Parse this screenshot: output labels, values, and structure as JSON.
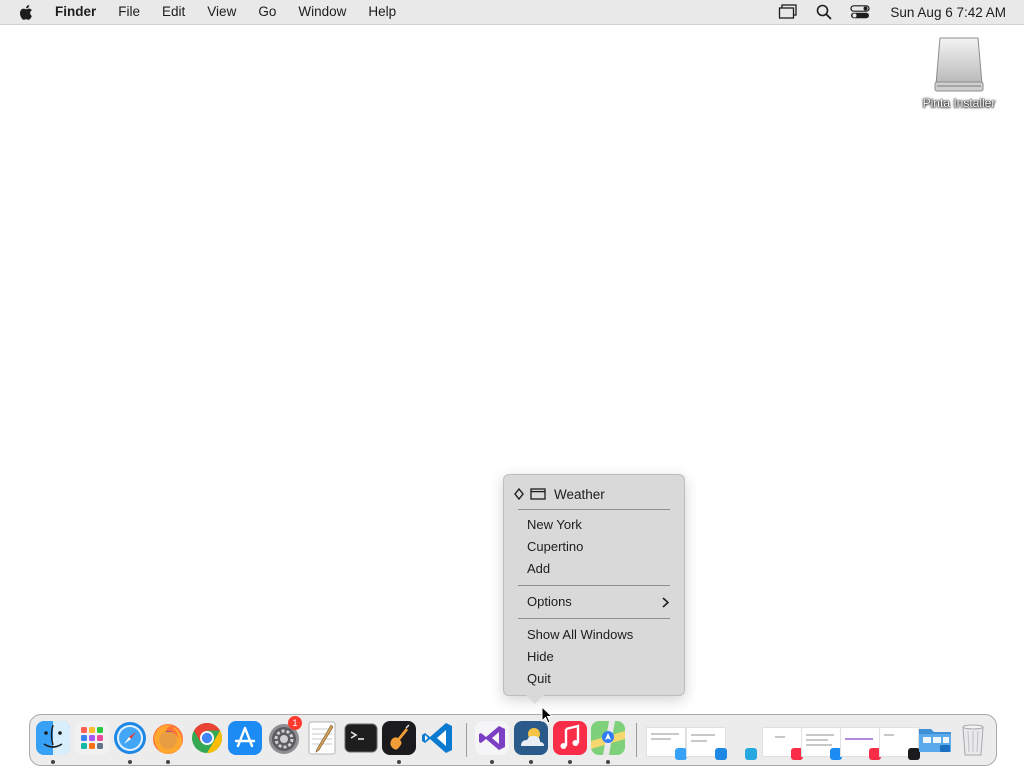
{
  "menubar": {
    "apple_icon": "apple-logo-icon",
    "app_name": "Finder",
    "items": [
      "File",
      "Edit",
      "View",
      "Go",
      "Window",
      "Help"
    ],
    "status_icons": [
      "display-icon",
      "search-icon",
      "control-center-icon"
    ],
    "clock": "Sun Aug 6  7:42 AM"
  },
  "desktop": {
    "disk_label": "Pinta Installer",
    "disk_icon": "external-disk-icon"
  },
  "context_menu": {
    "window_title": "Weather",
    "items": [
      "New York",
      "Cupertino",
      "Add"
    ],
    "options_label": "Options",
    "window_actions": [
      "Show All Windows",
      "Hide",
      "Quit"
    ]
  },
  "dock": {
    "apps": [
      {
        "name": "Finder",
        "icon": "finder-icon",
        "running": true
      },
      {
        "name": "Launchpad",
        "icon": "launchpad-icon",
        "running": false
      },
      {
        "name": "Safari",
        "icon": "safari-icon",
        "running": true
      },
      {
        "name": "Firefox",
        "icon": "firefox-icon",
        "running": true
      },
      {
        "name": "Chrome",
        "icon": "chrome-icon",
        "running": false
      },
      {
        "name": "App Store",
        "icon": "app-store-icon",
        "running": false
      },
      {
        "name": "System Settings",
        "icon": "settings-icon",
        "running": false,
        "badge": "1"
      },
      {
        "name": "TextEdit",
        "icon": "textedit-icon",
        "running": false
      },
      {
        "name": "Terminal",
        "icon": "terminal-icon",
        "running": false
      },
      {
        "name": "GarageBand",
        "icon": "garageband-icon",
        "running": true
      },
      {
        "name": "VS Code",
        "icon": "vscode-icon",
        "running": false
      },
      {
        "name": "Visual Studio",
        "icon": "visual-studio-icon",
        "running": true
      },
      {
        "name": "Weather",
        "icon": "weather-icon",
        "running": true
      },
      {
        "name": "Music",
        "icon": "music-icon",
        "running": true
      },
      {
        "name": "Maps",
        "icon": "maps-icon",
        "running": true
      }
    ],
    "minimized_windows": 7,
    "folder_icon": "downloads-folder-icon",
    "trash_icon": "trash-icon"
  },
  "colors": {
    "menubar_bg": "#e9e9e9",
    "menu_bg": "#d9d9d9",
    "desktop_bg": "#ffffff"
  }
}
